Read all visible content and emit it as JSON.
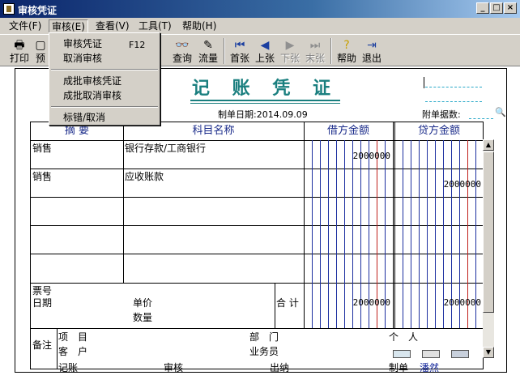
{
  "window": {
    "title": "审核凭证"
  },
  "menu": [
    "文件(F)",
    "审核(E)",
    "查看(V)",
    "工具(T)",
    "帮助(H)"
  ],
  "toolbar": {
    "print": "打印",
    "preview": "预",
    "query": "查询",
    "flow": "流量",
    "first": "首张",
    "prev": "上张",
    "next": "下张",
    "last": "末张",
    "help": "帮助",
    "exit": "退出"
  },
  "dropdown": {
    "audit": "审核凭证",
    "audit_key": "F12",
    "cancel_audit": "取消审核",
    "batch_audit": "成批审核凭证",
    "batch_cancel": "成批取消审核",
    "mark_error": "标错/取消"
  },
  "voucher": {
    "title": "记 账 凭 证",
    "date_label": "制单日期:",
    "date": "2014.09.09",
    "attach_label": "附单据数:",
    "headers": {
      "summary": "摘 要",
      "account": "科目名称",
      "debit": "借方金额",
      "credit": "贷方金额"
    },
    "rows": [
      {
        "summary": "销售",
        "account": "银行存款/工商银行",
        "debit": "2000000",
        "credit": ""
      },
      {
        "summary": "销售",
        "account": "应收账款",
        "debit": "",
        "credit": "2000000"
      }
    ],
    "ticket_no": "票号",
    "ticket_date": "日期",
    "unit_price": "单价",
    "quantity": "数量",
    "total_label": "合 计",
    "total_debit": "2000000",
    "total_credit": "2000000",
    "remark": "备注",
    "project": "项　目",
    "customer": "客　户",
    "department": "部　门",
    "salesperson": "业务员",
    "person": "个　人"
  },
  "footer": {
    "bookkeep": "记账",
    "audit": "审核",
    "cashier": "出纳",
    "maker": "制单",
    "maker_name": "潘然"
  },
  "colors": {
    "accent": "#1a7f7f",
    "debit_line": "#1c2fa0",
    "red_line": "#c0201c",
    "title_bar": "#0a246a"
  }
}
